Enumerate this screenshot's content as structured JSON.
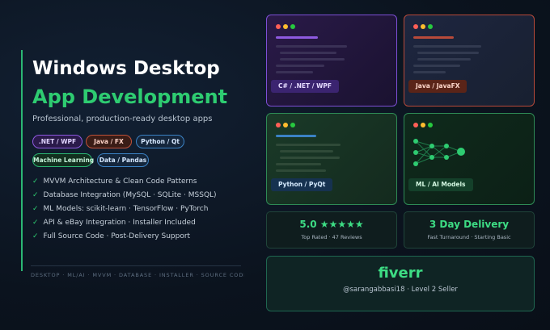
{
  "hero": {
    "title_line1": "Windows Desktop",
    "title_line2": "App Development",
    "subtitle": "Professional, production-ready desktop apps"
  },
  "chips": [
    {
      "label": ".NET / WPF"
    },
    {
      "label": "Java / FX"
    },
    {
      "label": "Python / Qt"
    },
    {
      "label": "Machine Learning"
    },
    {
      "label": "Data / Pandas"
    }
  ],
  "features": [
    {
      "check": "✓",
      "text": "MVVM Architecture & Clean Code Patterns"
    },
    {
      "check": "✓",
      "text": "Database Integration (MySQL · SQLite · MSSQL)"
    },
    {
      "check": "✓",
      "text": "ML Models: scikit-learn · TensorFlow · PyTorch"
    },
    {
      "check": "✓",
      "text": "API & eBay Integration · Installer Included"
    },
    {
      "check": "✓",
      "text": "Full Source Code · Post-Delivery Support"
    }
  ],
  "tagline": "DESKTOP · ML/AI · MVVM · DATABASE · INSTALLER · SOURCE CODE",
  "cards": [
    {
      "label": "C# / .NET / WPF"
    },
    {
      "label": "Java / JavaFX"
    },
    {
      "label": "Python / PyQt"
    },
    {
      "label": "ML / AI Models"
    }
  ],
  "stats": {
    "rating_value": "5.0 ★★★★★",
    "rating_caption": "Top Rated · 47 Reviews",
    "delivery_value": "3 Day Delivery",
    "delivery_caption": "Fast Turnaround · Starting Basic"
  },
  "seller": {
    "brand": "fiverr",
    "handle": "@sarangabbasi18 · Level 2 Seller"
  },
  "colors": {
    "accent_green": "#2ecc71",
    "purple": "#8e5ae0",
    "red": "#c0523a",
    "blue": "#3b82c4",
    "background": "#0c1420"
  }
}
